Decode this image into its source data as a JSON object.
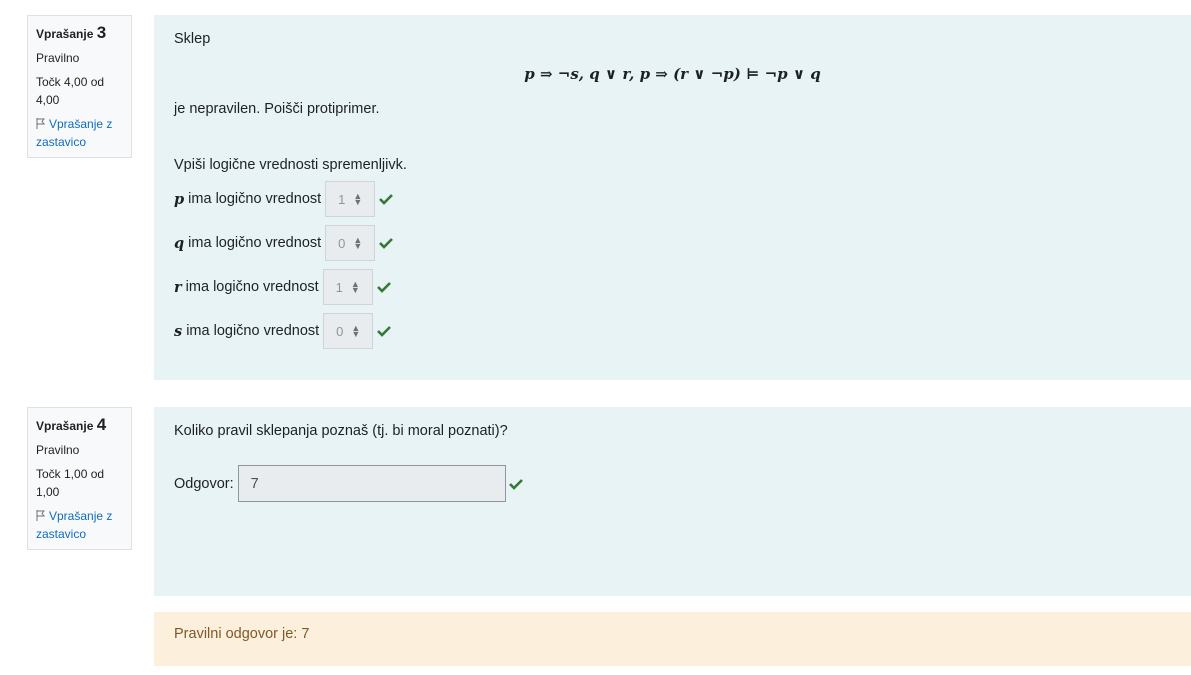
{
  "q3": {
    "label": "Vprašanje",
    "number": "3",
    "state": "Pravilno",
    "grade": "Točk 4,00 od 4,00",
    "flag": "Vprašanje z zastavico",
    "intro": "Sklep",
    "formula": "p ⇒ ¬s, q ∨ r, p ⇒ (r ∨ ¬p) ⊨ ¬p ∨ q",
    "statement": "je nepravilen. Poišči protiprimer.",
    "instruction": "Vpiši logične vrednosti spremenljivk.",
    "rows": [
      {
        "var": "p",
        "text": "ima logično vrednost",
        "value": "1"
      },
      {
        "var": "q",
        "text": "ima logično vrednost",
        "value": "0"
      },
      {
        "var": "r",
        "text": "ima logično vrednost",
        "value": "1"
      },
      {
        "var": "s",
        "text": "ima logično vrednost",
        "value": "0"
      }
    ]
  },
  "q4": {
    "label": "Vprašanje",
    "number": "4",
    "state": "Pravilno",
    "grade": "Točk 1,00 od 1,00",
    "flag": "Vprašanje z zastavico",
    "question": "Koliko pravil sklepanja poznaš (tj. bi moral poznati)?",
    "answer_label": "Odgovor:",
    "answer_value": "7",
    "feedback": "Pravilni odgovor je: 7"
  },
  "colors": {
    "correct": "#357a32",
    "link": "#0f6cbf",
    "formulation_bg": "#e7f3f5",
    "feedback_bg": "#fcefdc"
  }
}
